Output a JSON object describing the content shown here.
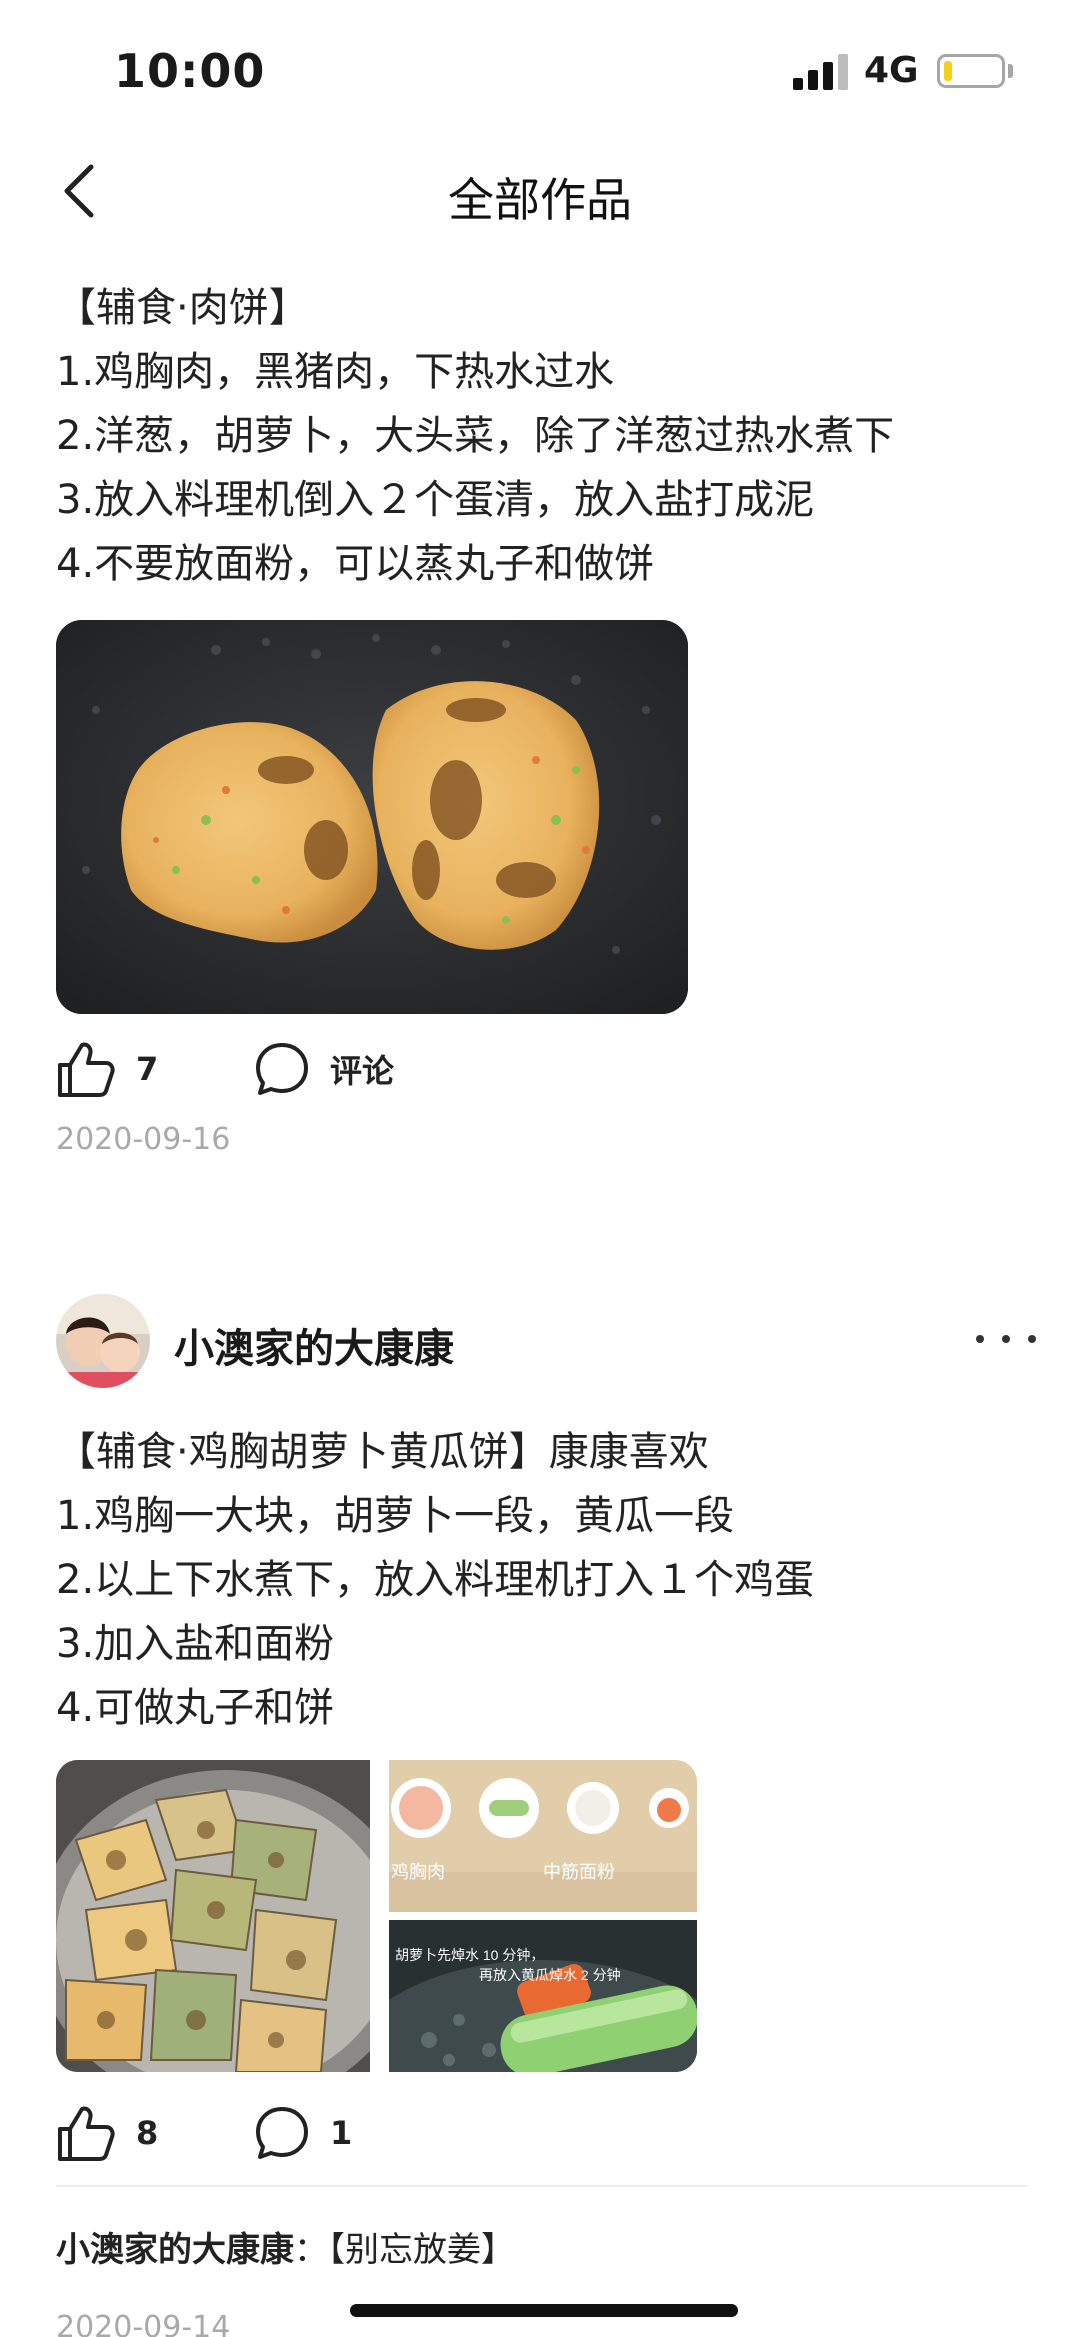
{
  "status_bar": {
    "time": "10:00",
    "network": "4G",
    "battery_level": 0.15
  },
  "nav": {
    "title": "全部作品"
  },
  "post1": {
    "lines": [
      "【辅食·肉饼】",
      "1.鸡胸肉，黑猪肉，下热水过水",
      "2.洋葱，胡萝卜，大头菜，除了洋葱过热水煮下",
      "3.放入料理机倒入２个蛋清，放入盐打成泥",
      "4.不要放面粉，可以蒸丸子和做饼"
    ],
    "likes": "7",
    "comment_label": "评论",
    "date": "2020-09-16"
  },
  "post2": {
    "author": "小澳家的大康康",
    "lines": [
      "【辅食·鸡胸胡萝卜黄瓜饼】康康喜欢",
      "1.鸡胸一大块，胡萝卜一段，黄瓜一段",
      "2.以上下水煮下，放入料理机打入１个鸡蛋",
      "3.加入盐和面粉",
      "4.可做丸子和饼"
    ],
    "photo_captions": {
      "left": "鸡胸肉",
      "right": "中筋面粉",
      "boil": "胡萝卜先焯水 10 分钟，",
      "boil2": "再放入黄瓜焯水 2 分钟"
    },
    "likes": "8",
    "comments": "1",
    "comment_author": "小澳家的大康康",
    "comment_text": "【别忘放姜】",
    "date": "2020-09-14"
  },
  "colors": {
    "accent": "#222222",
    "muted": "#a9a9a9",
    "battery": "#f5cf1c"
  }
}
